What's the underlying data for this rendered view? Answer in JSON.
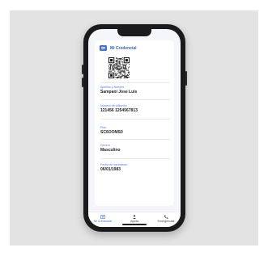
{
  "app": {
    "card_title": "Mi Credencial"
  },
  "fields": [
    {
      "label": "Apellido y Nombre",
      "value": "Sampani Jose Luis"
    },
    {
      "label": "Número de afiliación",
      "value": "121456 1254567813"
    },
    {
      "label": "Plan",
      "value": "SC6OOMS0"
    },
    {
      "label": "Género",
      "value": "Masculino"
    },
    {
      "label": "Fecha de nacimiento",
      "value": "06/01/1983"
    }
  ],
  "tabs": [
    {
      "label": "Mi Credencial",
      "icon": "id-card-icon",
      "active": true
    },
    {
      "label": "Ayuda",
      "icon": "help-icon",
      "active": false
    },
    {
      "label": "Emergencias",
      "icon": "phone-icon",
      "active": false
    }
  ],
  "colors": {
    "accent": "#3f6fd8",
    "background": "#e3e3e3",
    "phone": "#1b1b1d"
  }
}
